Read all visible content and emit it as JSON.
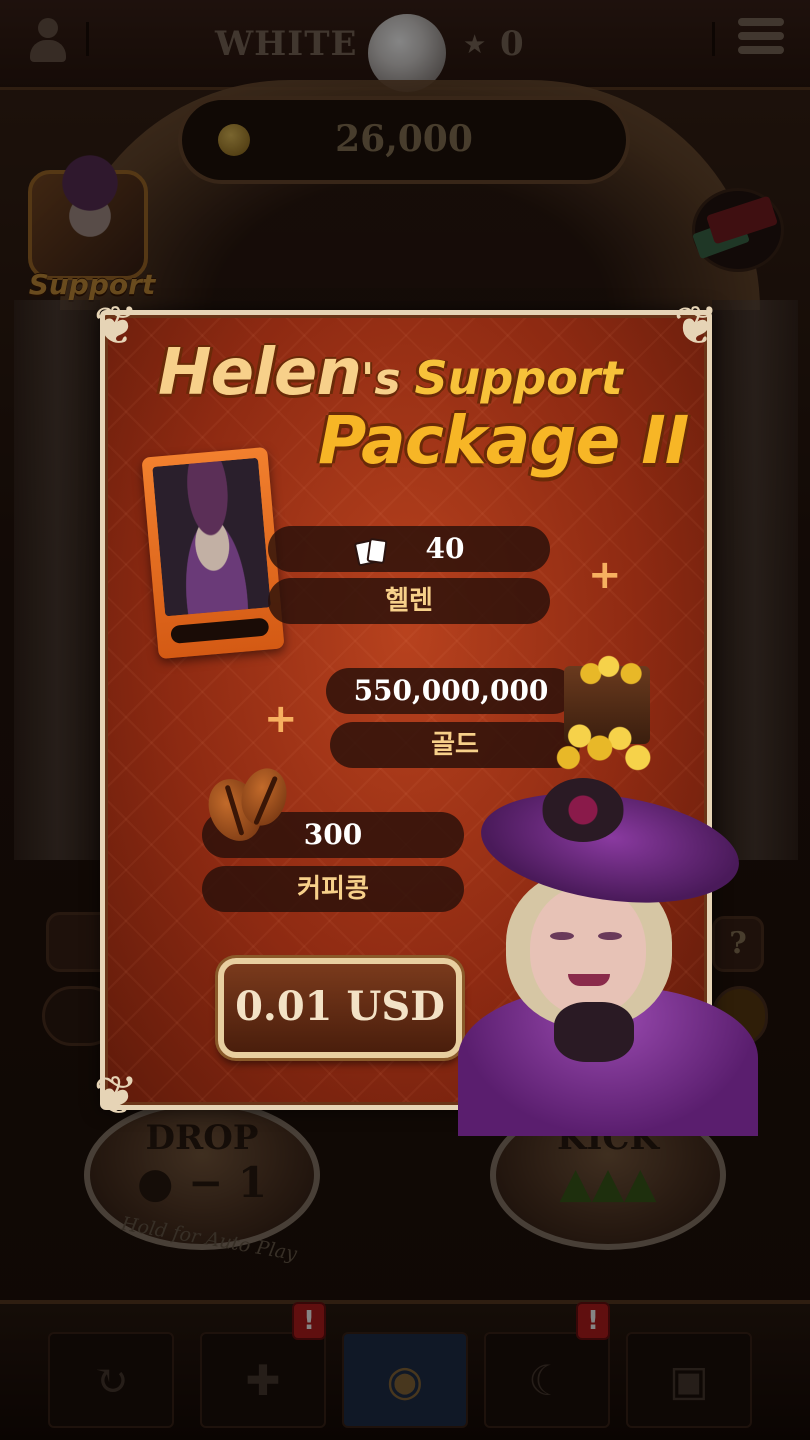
{
  "top_bar": {
    "mode_label": "WHITE",
    "stars": "0",
    "gold": "26,000"
  },
  "support_badge": {
    "label": "Support"
  },
  "side_help": "?",
  "game_buttons": {
    "drop_label": "DROP",
    "drop_value": "● − 1",
    "kick_label": "KICK",
    "hold_hint": "Hold for Auto Play"
  },
  "bottom_nav": {
    "alert_symbol": "!"
  },
  "package": {
    "title_name": "Helen",
    "title_possessive": "'s",
    "title_support": "Support",
    "title_package": "Package II",
    "card_count": "40",
    "card_name": "헬렌",
    "plus_symbol": "+",
    "gold_amount": "550,000,000",
    "gold_label": "골드",
    "coffee_amount": "300",
    "coffee_label": "커피콩",
    "price": "0.01 USD"
  },
  "colors": {
    "popup_red": "#8e2a12",
    "frame_cream": "#e6d4b6",
    "title_gold": "#f7b626",
    "alert_red": "#b81e1e"
  }
}
